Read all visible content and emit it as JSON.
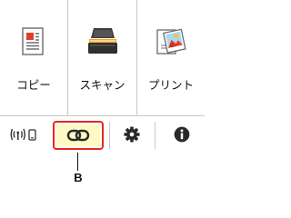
{
  "tiles": [
    {
      "label": "コピー",
      "icon": "copy-document-icon"
    },
    {
      "label": "スキャン",
      "icon": "scanner-icon"
    },
    {
      "label": "プリント",
      "icon": "print-photo-icon"
    }
  ],
  "toolbar": {
    "wireless_icon": "wireless-network-icon",
    "link_icon": "chain-link-icon",
    "settings_icon": "gear-icon",
    "info_icon": "info-icon"
  },
  "callout": {
    "label": "B"
  },
  "colors": {
    "highlight_border": "#e8271f",
    "highlight_fill": "#fff9c4",
    "divider": "#c9c9c9",
    "icon_dark": "#333333"
  }
}
